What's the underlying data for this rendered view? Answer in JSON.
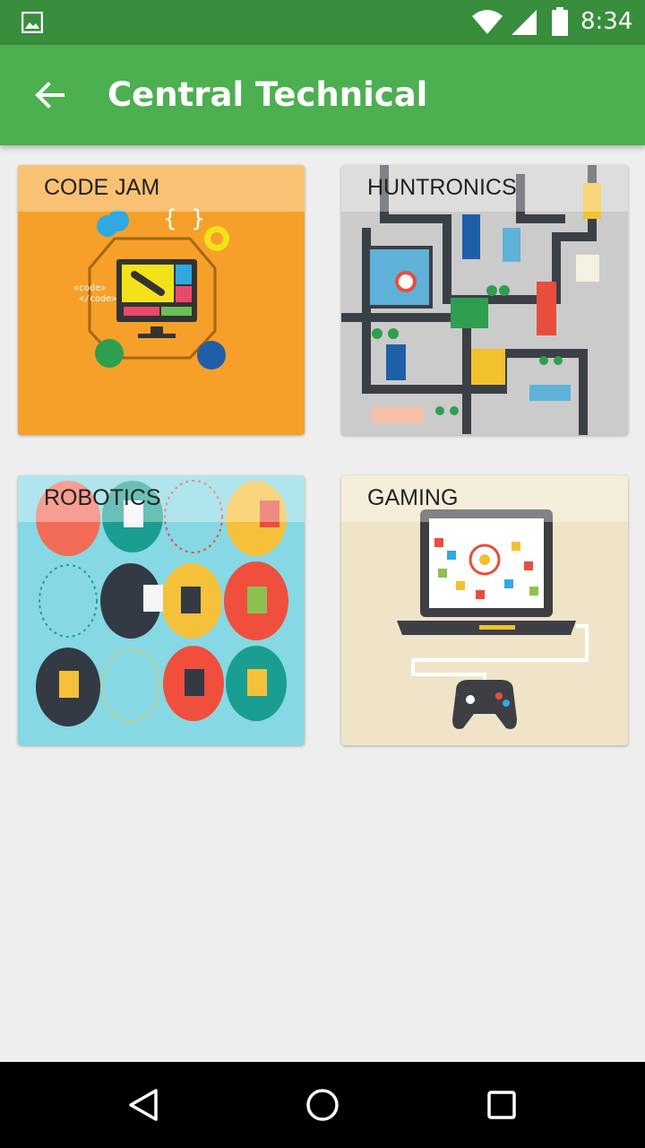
{
  "status_bar": {
    "time": "8:34",
    "icons": [
      "image-icon",
      "wifi-icon",
      "signal-icon",
      "battery-icon"
    ]
  },
  "app_bar": {
    "title": "Central Technical",
    "back_icon": "arrow-back-icon",
    "color": "#4caf50"
  },
  "cards": [
    {
      "label": "CODE JAM",
      "color": "#f6a02a"
    },
    {
      "label": "HUNTRONICS",
      "color": "#cbcbcb"
    },
    {
      "label": "ROBOTICS",
      "color": "#86d8e4"
    },
    {
      "label": "GAMING",
      "color": "#efe4c7"
    }
  ],
  "nav_bar": {
    "icons": [
      "back-triangle-icon",
      "home-circle-icon",
      "recents-square-icon"
    ]
  }
}
